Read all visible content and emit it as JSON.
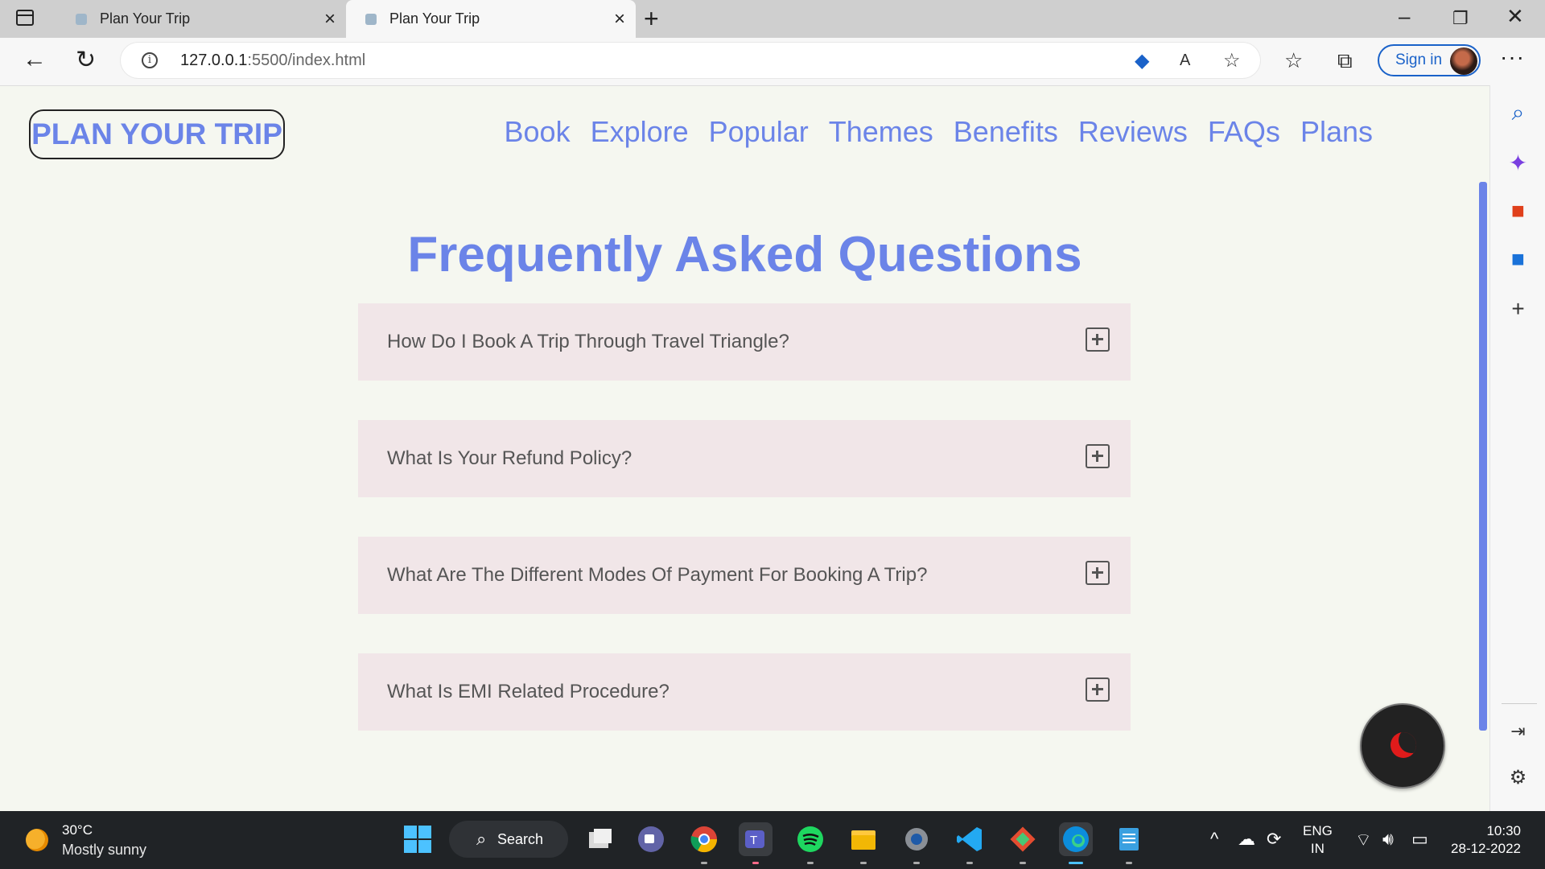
{
  "browser": {
    "tabs": [
      {
        "title": "Plan Your Trip",
        "active": false
      },
      {
        "title": "Plan Your Trip",
        "active": true
      }
    ],
    "url_host": "127.0.0.1",
    "url_rest": ":5500/index.html",
    "sign_in_label": "Sign in",
    "more_label": "···"
  },
  "site": {
    "logo": "PLAN YOUR TRIP",
    "nav": [
      "Book",
      "Explore",
      "Popular",
      "Themes",
      "Benefits",
      "Reviews",
      "FAQs",
      "Plans"
    ],
    "faq_title": "Frequently Asked Questions",
    "faqs": [
      "How Do I Book A Trip Through Travel Triangle?",
      "What Is Your Refund Policy?",
      "What Are The Different Modes Of Payment For Booking A Trip?",
      "What Is EMI Related Procedure?"
    ]
  },
  "taskbar": {
    "weather_temp": "30°C",
    "weather_desc": "Mostly sunny",
    "search_label": "Search",
    "lang_top": "ENG",
    "lang_bottom": "IN",
    "time": "10:30",
    "date": "28-12-2022"
  },
  "colors": {
    "accent": "#6b84e8",
    "faq_bg": "#f1e6e8",
    "page_bg": "#f5f7f0",
    "moon": "#e01b1b"
  }
}
